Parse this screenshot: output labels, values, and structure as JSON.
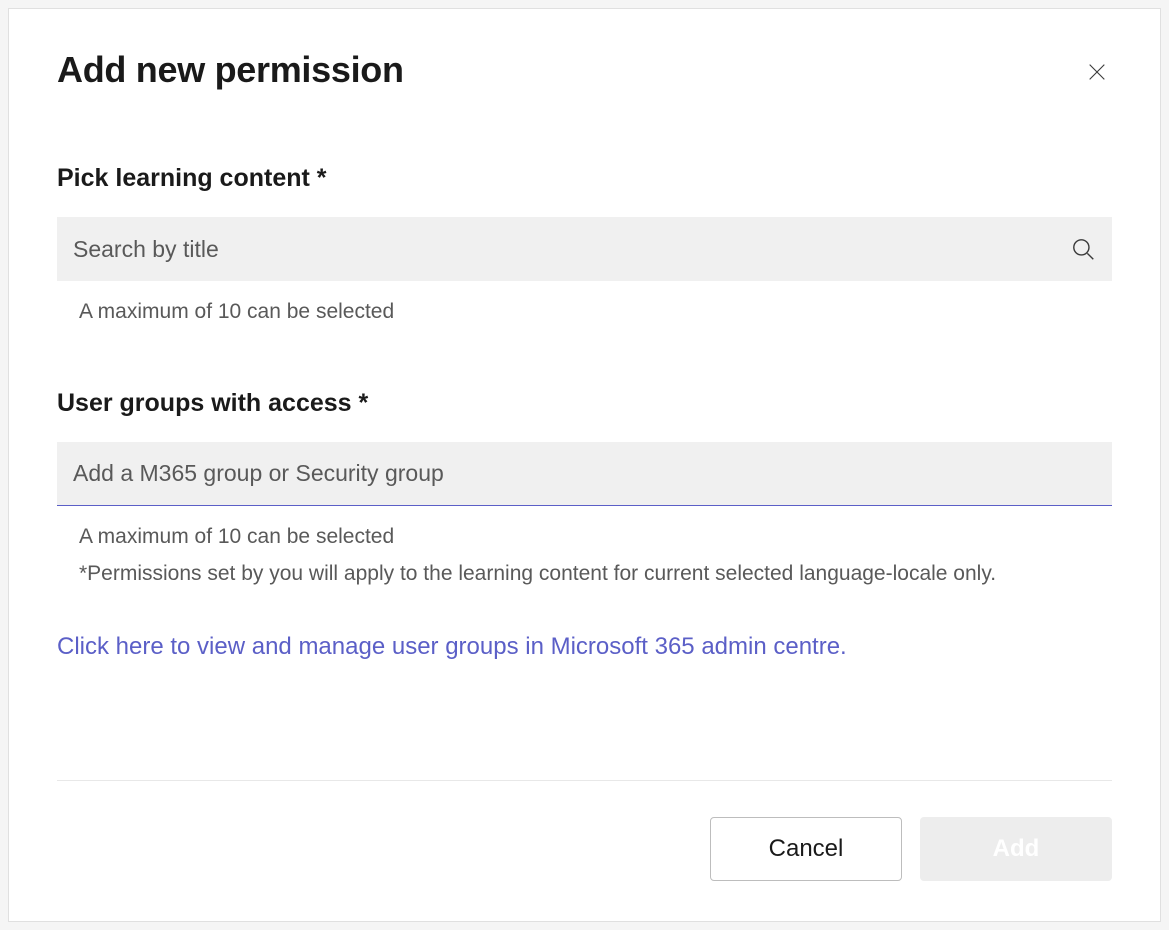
{
  "dialog": {
    "title": "Add new permission"
  },
  "field_content": {
    "label": "Pick learning content *",
    "placeholder": "Search by title",
    "helper": "A maximum of 10 can be selected"
  },
  "field_groups": {
    "label": "User groups with access *",
    "placeholder": "Add a M365 group or Security group",
    "helper1": "A maximum of 10 can be selected",
    "helper2": "*Permissions set by you will apply to the learning content for current selected language-locale only."
  },
  "link": {
    "text": "Click here to view and manage user groups in Microsoft 365 admin centre."
  },
  "footer": {
    "cancel": "Cancel",
    "add": "Add"
  }
}
